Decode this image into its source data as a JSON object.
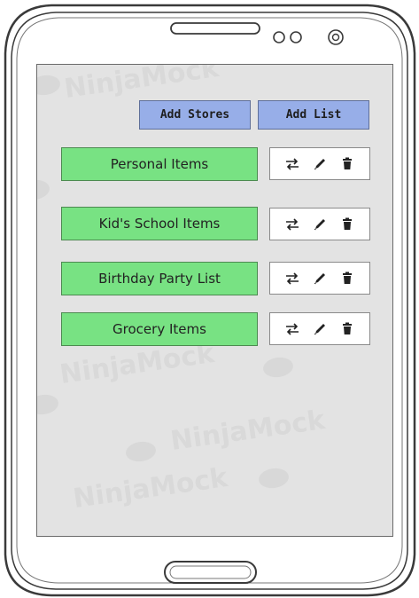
{
  "watermark": {
    "text": "NinjaMock"
  },
  "header_buttons": {
    "add_stores_label": "Add Stores",
    "add_list_label": "Add List"
  },
  "lists": [
    {
      "label": "Personal Items"
    },
    {
      "label": "Kid's School Items"
    },
    {
      "label": "Birthday Party List"
    },
    {
      "label": "Grocery Items"
    }
  ],
  "icons": {
    "share": "swap-arrows-icon",
    "edit": "pencil-icon",
    "delete": "trash-icon"
  },
  "colors": {
    "screen_bg": "#e3e3e3",
    "header_button_bg": "#97aee8",
    "list_button_bg": "#78e283",
    "action_box_bg": "#ffffff"
  }
}
